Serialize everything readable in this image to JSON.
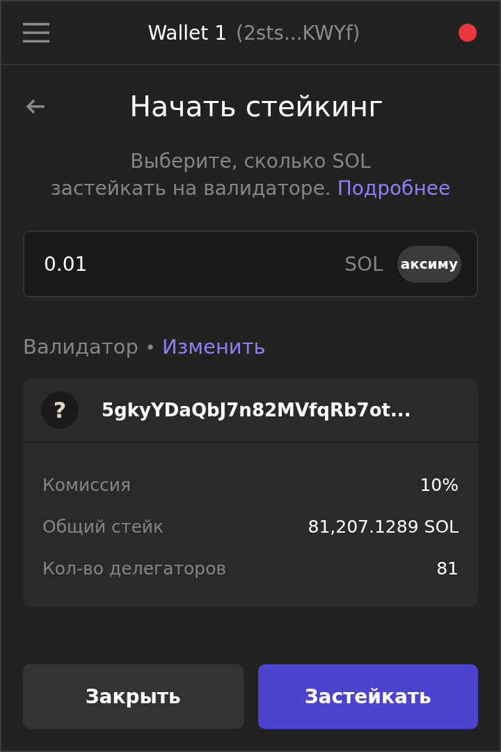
{
  "header": {
    "wallet_name": "Wallet 1",
    "address": "(2sts...KWYf)"
  },
  "page": {
    "title": "Начать стейкинг",
    "description": "Выберите, сколько SOL\nзастейкать на валидаторе.",
    "link": "Подробнее"
  },
  "amount": {
    "value": "0.01",
    "unit": "SOL",
    "max_button": "аксиму"
  },
  "validator": {
    "label": "Валидатор",
    "separator": "•",
    "change_link": "Изменить",
    "avatar": "?",
    "name": "5gkyYDaQbJ7n82MVfqRb7ot...",
    "stats": [
      {
        "label": "Комиссия",
        "value": "10%"
      },
      {
        "label": "Общий стейк",
        "value": "81,207.1289 SOL"
      },
      {
        "label": "Кол-во делегаторов",
        "value": "81"
      }
    ]
  },
  "buttons": [
    {
      "label": "Закрыть",
      "kind": "secondary"
    },
    {
      "label": "Застейкать",
      "kind": "primary"
    }
  ]
}
